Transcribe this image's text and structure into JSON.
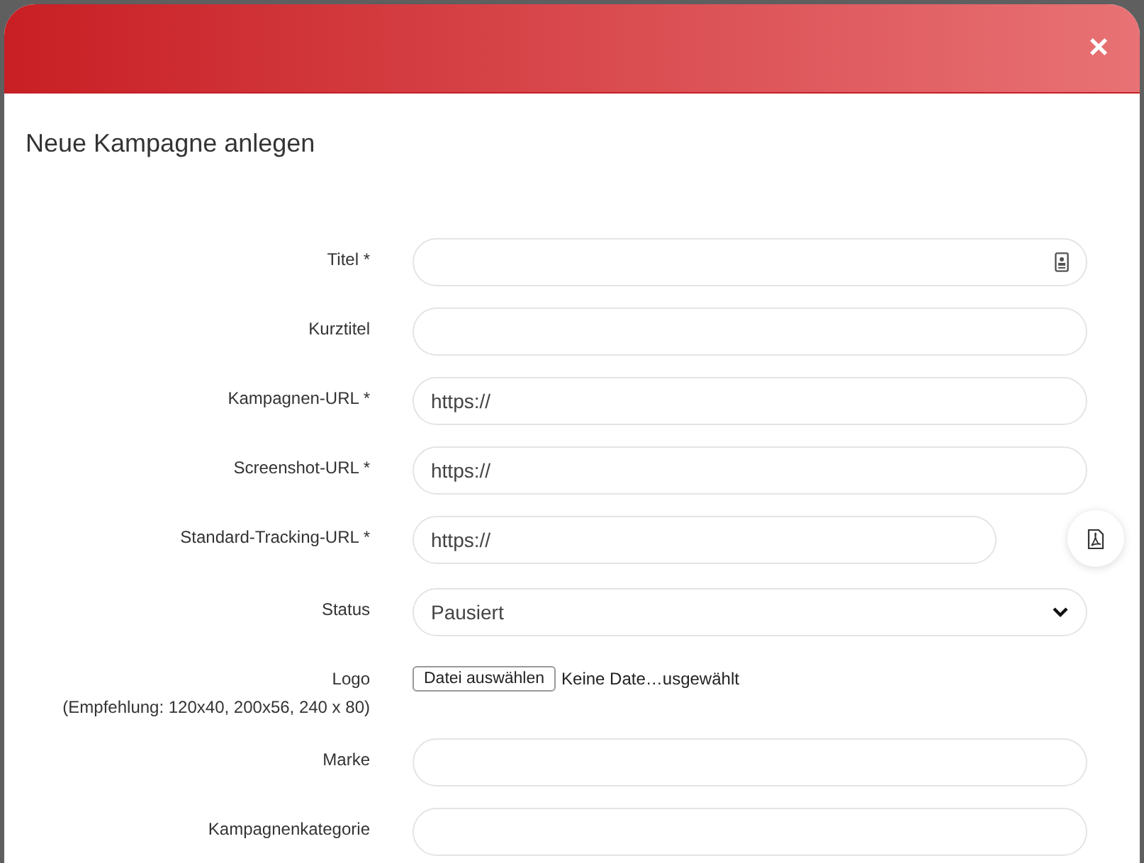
{
  "dialog": {
    "close_symbol": "×",
    "title": "Neue Kampagne anlegen"
  },
  "fields": [
    {
      "kind": "text_with_icon",
      "label": "Titel *"
    },
    {
      "kind": "text",
      "label": "Kurztitel"
    },
    {
      "kind": "text",
      "label": "Kampagnen-URL *",
      "value": "https://"
    },
    {
      "kind": "text",
      "label": "Screenshot-URL *",
      "value": "https://"
    },
    {
      "kind": "text_with_button",
      "label": "Standard-Tracking-URL *",
      "value": "https://"
    },
    {
      "kind": "select",
      "label": "Status",
      "value": "Pausiert"
    },
    {
      "kind": "file",
      "label": "Logo",
      "hint": "(Empfehlung: 120x40, 200x56, 240 x 80)",
      "button": "Datei auswählen",
      "file_name": "Keine Date…usgewählt"
    },
    {
      "kind": "text",
      "label": "Marke"
    },
    {
      "kind": "text",
      "label": "Kampagnenkategorie"
    }
  ]
}
